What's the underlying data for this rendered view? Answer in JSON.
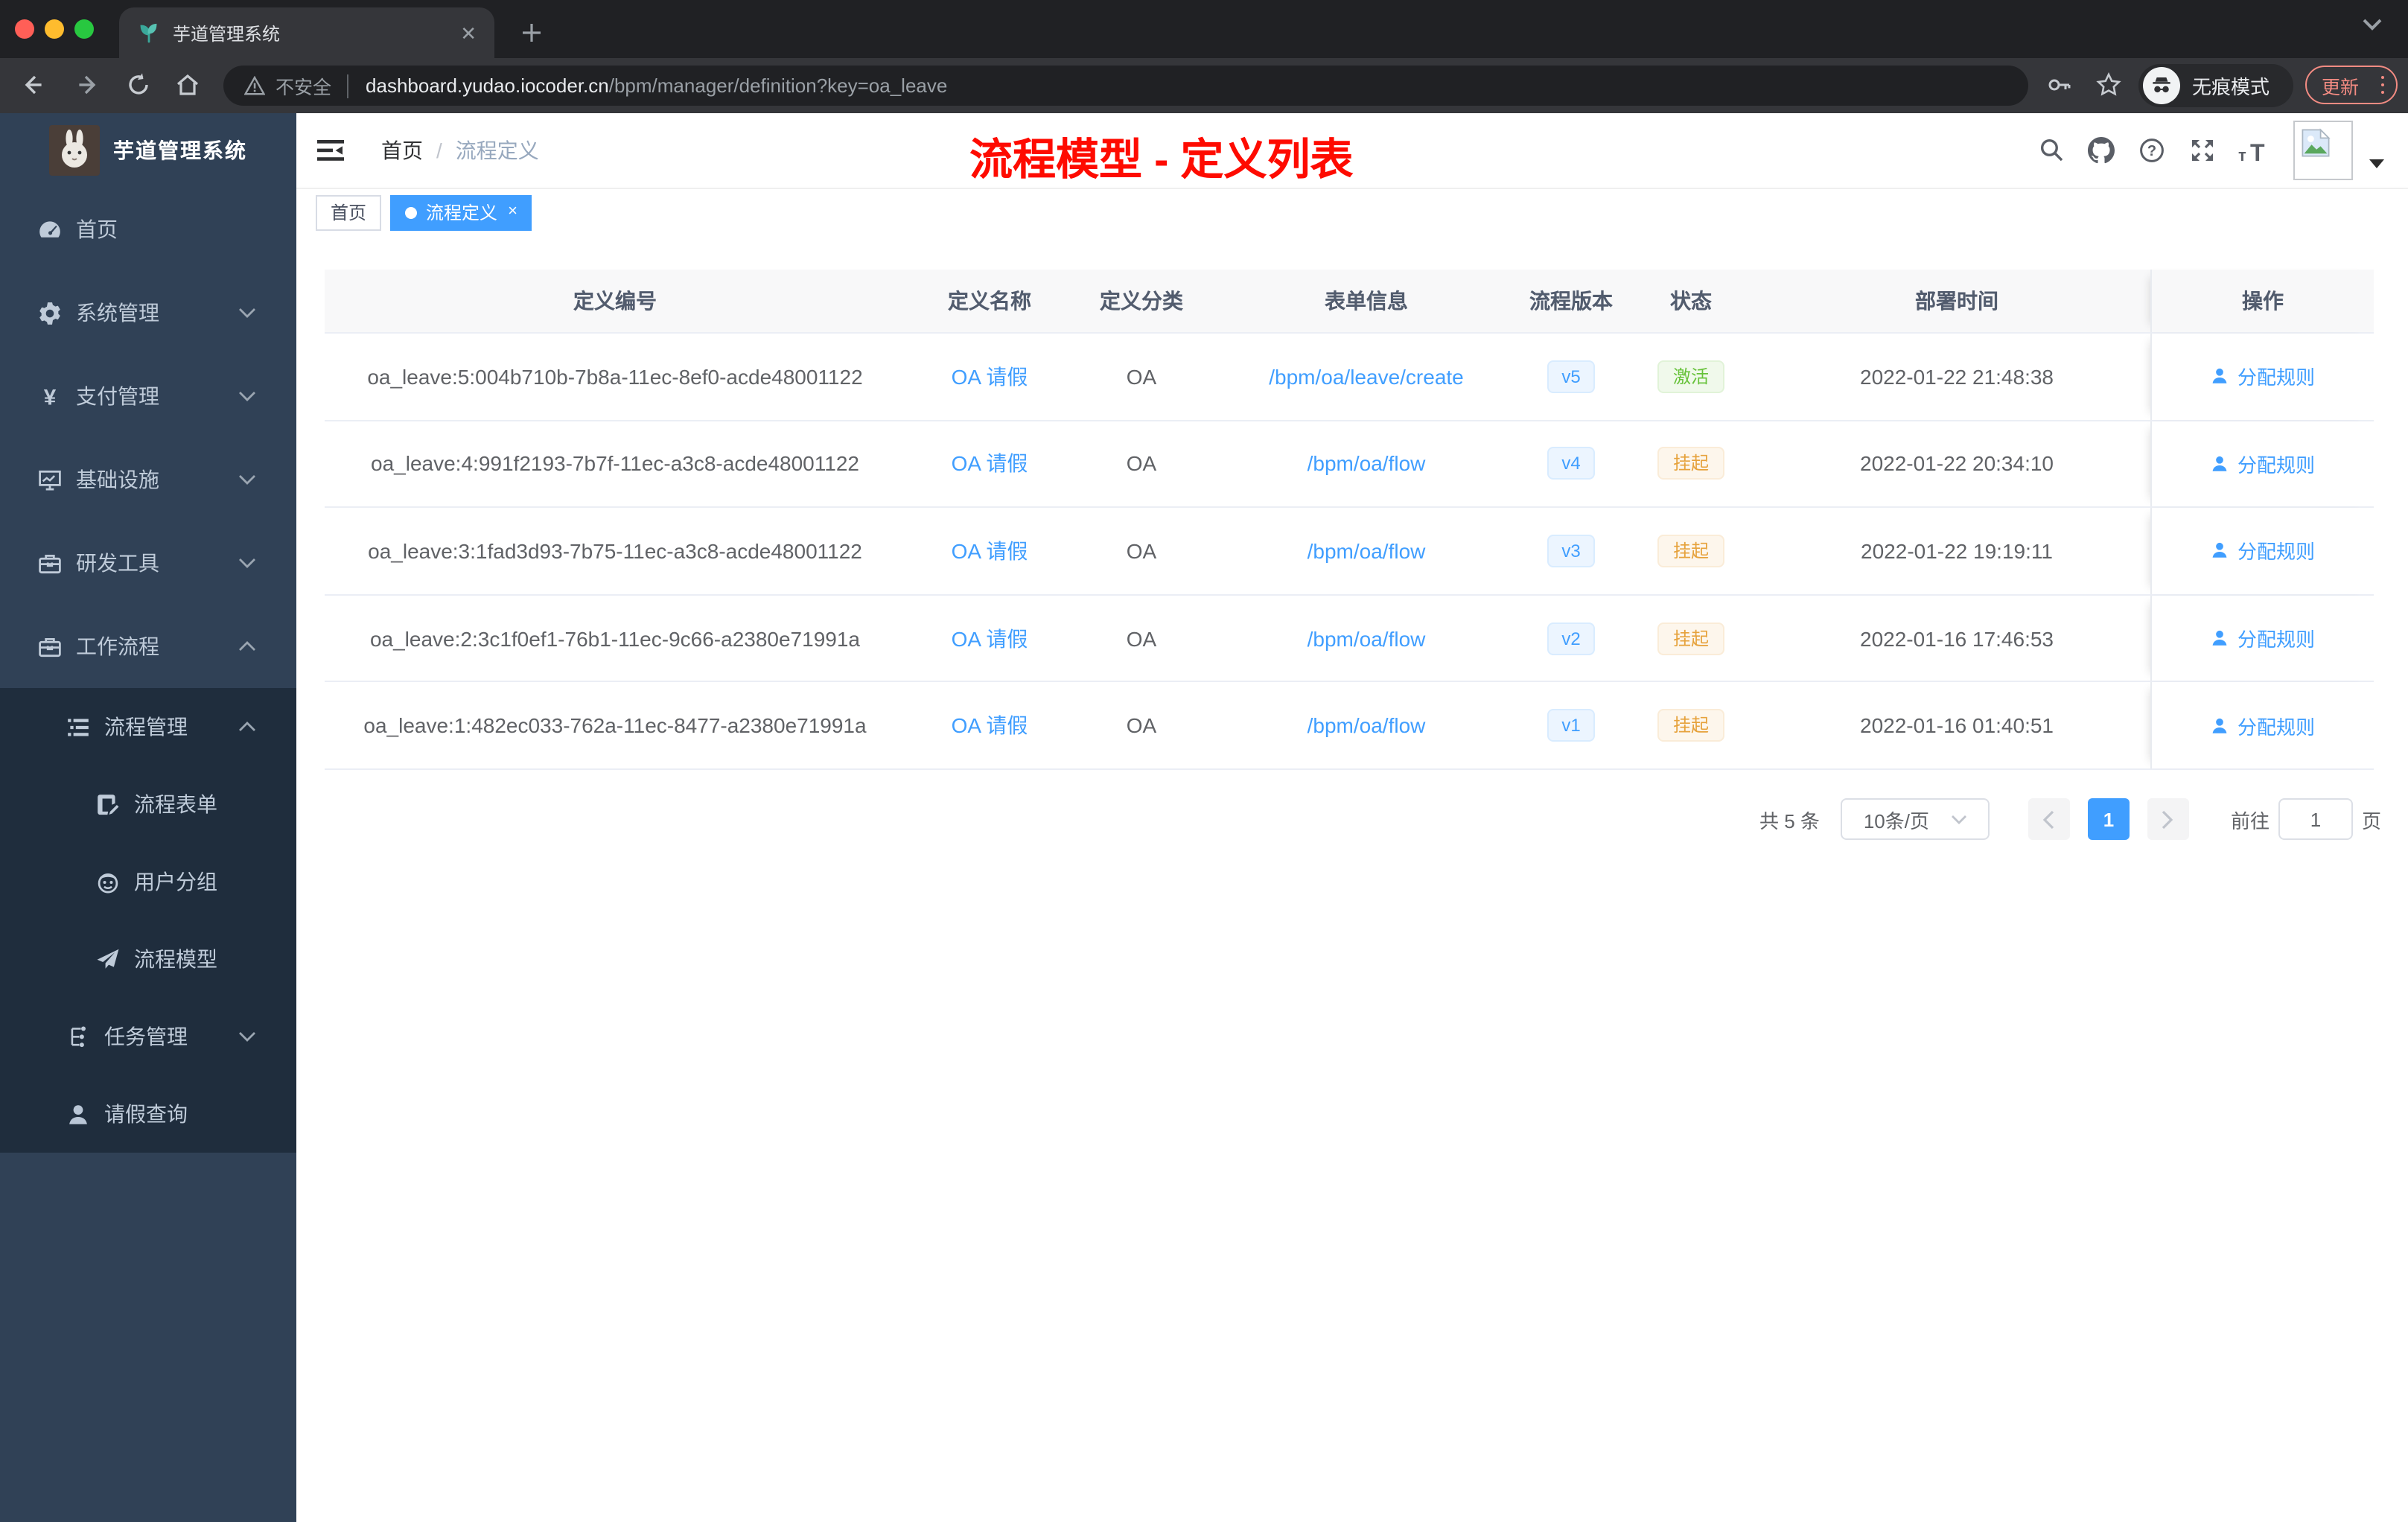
{
  "browser": {
    "tab": {
      "title": "芋道管理系统"
    },
    "toolbar": {
      "security_label": "不安全",
      "url_domain": "dashboard.yudao.iocoder.cn",
      "url_path": "/bpm/manager/definition?key=oa_leave",
      "incognito_label": "无痕模式",
      "update_label": "更新"
    }
  },
  "sidebar": {
    "logo_title": "芋道管理系统",
    "menu": [
      {
        "key": "home",
        "label": "首页",
        "icon": "dashboard-icon",
        "level": 1,
        "chevron": ""
      },
      {
        "key": "system",
        "label": "系统管理",
        "icon": "gear-icon",
        "level": 1,
        "chevron": "down"
      },
      {
        "key": "payment",
        "label": "支付管理",
        "icon": "yen-icon",
        "level": 1,
        "chevron": "down"
      },
      {
        "key": "infra",
        "label": "基础设施",
        "icon": "monitor-icon",
        "level": 1,
        "chevron": "down"
      },
      {
        "key": "devtools",
        "label": "研发工具",
        "icon": "toolbox-icon",
        "level": 1,
        "chevron": "down"
      },
      {
        "key": "workflow",
        "label": "工作流程",
        "icon": "briefcase-icon",
        "level": 1,
        "chevron": "up"
      },
      {
        "key": "process-mgmt",
        "label": "流程管理",
        "icon": "list-icon",
        "level": 2,
        "chevron": "up"
      },
      {
        "key": "process-form",
        "label": "流程表单",
        "icon": "form-icon",
        "level": 3,
        "chevron": ""
      },
      {
        "key": "user-group",
        "label": "用户分组",
        "icon": "robot-icon",
        "level": 3,
        "chevron": ""
      },
      {
        "key": "process-model",
        "label": "流程模型",
        "icon": "paper-plane-icon",
        "level": 3,
        "chevron": ""
      },
      {
        "key": "task-mgmt",
        "label": "任务管理",
        "icon": "tree-icon",
        "level": 2,
        "chevron": "down"
      },
      {
        "key": "leave-query",
        "label": "请假查询",
        "icon": "user-icon",
        "level": 2,
        "chevron": ""
      }
    ]
  },
  "header": {
    "breadcrumb": [
      "首页",
      "流程定义"
    ],
    "annotation": "流程模型 - 定义列表"
  },
  "tags": [
    {
      "label": "首页",
      "active": false,
      "closable": false
    },
    {
      "label": "流程定义",
      "active": true,
      "closable": true
    }
  ],
  "table": {
    "headers": [
      "定义编号",
      "定义名称",
      "定义分类",
      "表单信息",
      "流程版本",
      "状态",
      "部署时间",
      "操作"
    ],
    "action_label": "分配规则",
    "rows": [
      {
        "id": "oa_leave:5:004b710b-7b8a-11ec-8ef0-acde48001122",
        "name": "OA 请假",
        "category": "OA",
        "form": "/bpm/oa/leave/create",
        "version": "v5",
        "status": "激活",
        "status_type": "success",
        "deploy_time": "2022-01-22 21:48:38"
      },
      {
        "id": "oa_leave:4:991f2193-7b7f-11ec-a3c8-acde48001122",
        "name": "OA 请假",
        "category": "OA",
        "form": "/bpm/oa/flow",
        "version": "v4",
        "status": "挂起",
        "status_type": "warning",
        "deploy_time": "2022-01-22 20:34:10"
      },
      {
        "id": "oa_leave:3:1fad3d93-7b75-11ec-a3c8-acde48001122",
        "name": "OA 请假",
        "category": "OA",
        "form": "/bpm/oa/flow",
        "version": "v3",
        "status": "挂起",
        "status_type": "warning",
        "deploy_time": "2022-01-22 19:19:11"
      },
      {
        "id": "oa_leave:2:3c1f0ef1-76b1-11ec-9c66-a2380e71991a",
        "name": "OA 请假",
        "category": "OA",
        "form": "/bpm/oa/flow",
        "version": "v2",
        "status": "挂起",
        "status_type": "warning",
        "deploy_time": "2022-01-16 17:46:53"
      },
      {
        "id": "oa_leave:1:482ec033-762a-11ec-8477-a2380e71991a",
        "name": "OA 请假",
        "category": "OA",
        "form": "/bpm/oa/flow",
        "version": "v1",
        "status": "挂起",
        "status_type": "warning",
        "deploy_time": "2022-01-16 01:40:51"
      }
    ]
  },
  "pagination": {
    "total": "共 5 条",
    "page_size": "10条/页",
    "current_page": "1",
    "goto_label": "前往",
    "goto_value": "1",
    "page_unit": "页"
  },
  "colors": {
    "primary": "#409eff",
    "success": "#67c23a",
    "warning": "#e6a23c",
    "annotation_red": "#fe0b00",
    "sidebar_bg": "#304156",
    "submenu_bg": "#1f2d3d"
  }
}
